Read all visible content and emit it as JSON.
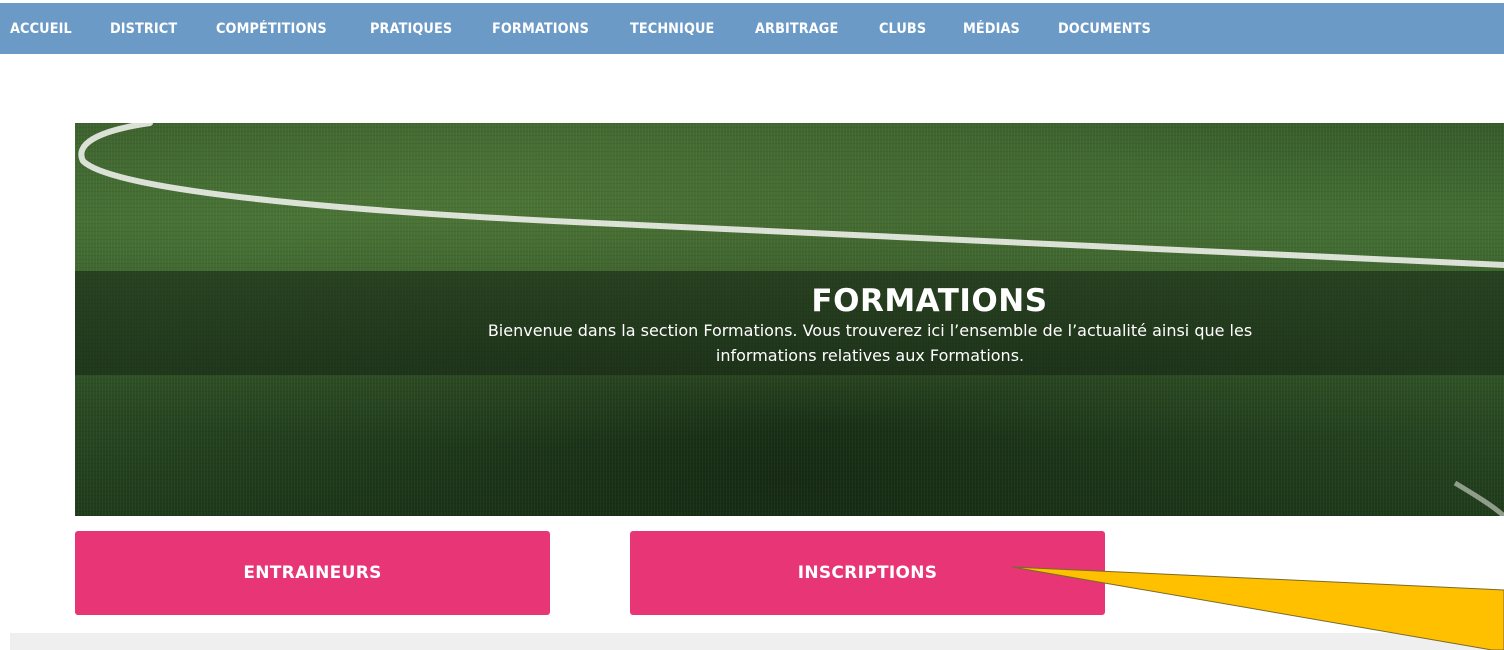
{
  "nav": {
    "items": [
      {
        "label": "ACCUEIL"
      },
      {
        "label": "DISTRICT"
      },
      {
        "label": "COMPÉTITIONS"
      },
      {
        "label": "PRATIQUES"
      },
      {
        "label": "FORMATIONS"
      },
      {
        "label": "TECHNIQUE"
      },
      {
        "label": "ARBITRAGE"
      },
      {
        "label": "CLUBS"
      },
      {
        "label": "MÉDIAS"
      },
      {
        "label": "DOCUMENTS"
      }
    ],
    "background_color": "#6b9ac7"
  },
  "hero": {
    "title": "FORMATIONS",
    "description_line1": "Bienvenue dans la section Formations. Vous trouverez ici l’ensemble de l’actualité ainsi que les",
    "description_line2": "informations relatives aux Formations."
  },
  "buttons": {
    "entraineurs": "ENTRAINEURS",
    "inscriptions": "INSCRIPTIONS",
    "color": "#e83576"
  },
  "annotation": {
    "arrow_color": "#ffc000",
    "icon": "callout-arrow"
  }
}
